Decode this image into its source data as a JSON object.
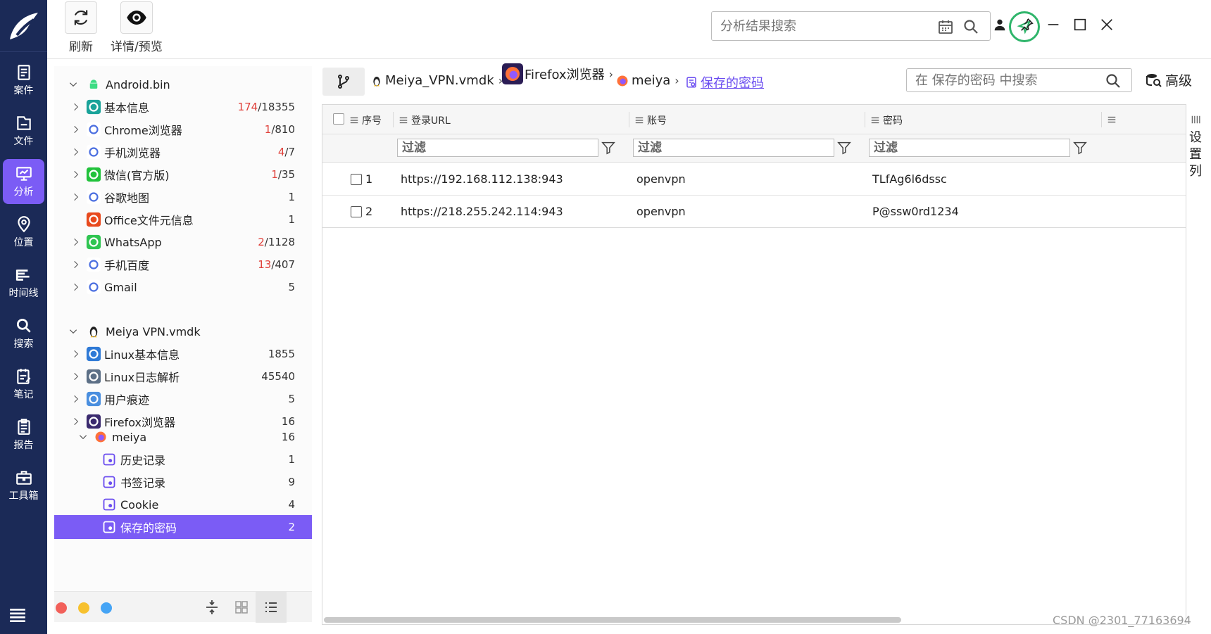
{
  "rail": {
    "items": [
      {
        "label": "案件",
        "icon": "case-icon"
      },
      {
        "label": "文件",
        "icon": "folder-icon"
      },
      {
        "label": "分析",
        "icon": "analysis-icon",
        "active": true
      },
      {
        "label": "位置",
        "icon": "location-icon"
      },
      {
        "label": "时间线",
        "icon": "timeline-icon"
      },
      {
        "label": "搜索",
        "icon": "search-icon"
      },
      {
        "label": "笔记",
        "icon": "note-icon"
      },
      {
        "label": "报告",
        "icon": "report-icon"
      },
      {
        "label": "工具箱",
        "icon": "toolbox-icon"
      }
    ]
  },
  "toolbar": {
    "refresh_label": "刷新",
    "detail_label": "详情/预览",
    "search_placeholder": "分析结果搜索"
  },
  "tree": {
    "source1": {
      "label": "Android.bin"
    },
    "source1_items": [
      {
        "label": "基本信息",
        "hit": "174",
        "total": "/18355",
        "icon": "basic-info-icon",
        "color": "#1aa39a"
      },
      {
        "label": "Chrome浏览器",
        "hit": "1",
        "total": "/810",
        "icon": "chrome-icon",
        "color": "#ffffff"
      },
      {
        "label": "手机浏览器",
        "hit": "4",
        "total": "/7",
        "icon": "mobile-browser-icon",
        "color": "#ffffff"
      },
      {
        "label": "微信(官方版)",
        "hit": "1",
        "total": "/35",
        "icon": "wechat-icon",
        "color": "#21c23b"
      },
      {
        "label": "谷歌地图",
        "hit": "",
        "total": "1",
        "icon": "google-maps-icon",
        "color": "#ffffff"
      },
      {
        "label": "Office文件元信息",
        "hit": "",
        "total": "1",
        "icon": "office-icon",
        "color": "#e8491d"
      },
      {
        "label": "WhatsApp",
        "hit": "2",
        "total": "/1128",
        "icon": "whatsapp-icon",
        "color": "#2fc551"
      },
      {
        "label": "手机百度",
        "hit": "13",
        "total": "/407",
        "icon": "baidu-icon",
        "color": "#ffffff"
      },
      {
        "label": "Gmail",
        "hit": "",
        "total": "5",
        "icon": "gmail-icon",
        "color": "#ffffff"
      }
    ],
    "source2": {
      "label": "Meiya VPN.vmdk"
    },
    "source2_items": [
      {
        "label": "Linux基本信息",
        "total": "1855",
        "icon": "linux-info-icon",
        "color": "#2f7ad6"
      },
      {
        "label": "Linux日志解析",
        "total": "45540",
        "icon": "log-icon",
        "color": "#5c6f86"
      },
      {
        "label": "用户痕迹",
        "total": "5",
        "icon": "user-trace-icon",
        "color": "#4a8fdf"
      },
      {
        "label": "Firefox浏览器",
        "total": "16",
        "icon": "firefox-icon",
        "color": "#3a2a6e"
      }
    ],
    "profile": {
      "label": "meiya",
      "total": "16"
    },
    "profile_items": [
      {
        "label": "历史记录",
        "total": "1",
        "icon": "history-icon"
      },
      {
        "label": "书签记录",
        "total": "9",
        "icon": "bookmark-icon"
      },
      {
        "label": "Cookie",
        "total": "4",
        "icon": "cookie-icon"
      },
      {
        "label": "保存的密码",
        "total": "2",
        "icon": "saved-password-icon",
        "selected": true
      }
    ]
  },
  "breadcrumb": {
    "items": [
      "Meiya_VPN.vmdk",
      "Firefox浏览器",
      "meiya",
      "保存的密码"
    ]
  },
  "local_search": {
    "placeholder": "在 保存的密码 中搜索"
  },
  "advanced_label": "高级",
  "table": {
    "columns": [
      "序号",
      "登录URL",
      "账号",
      "密码"
    ],
    "filter_placeholder": "过滤",
    "rows": [
      {
        "index": "1",
        "url": "https://192.168.112.138:943",
        "account": "openvpn",
        "password": "TLfAg6l6dssc"
      },
      {
        "index": "2",
        "url": "https://218.255.242.114:943",
        "account": "openvpn",
        "password": "P@ssw0rd1234"
      }
    ]
  },
  "column_setting_label": [
    "设",
    "置",
    "列"
  ],
  "watermark": "CSDN @2301_77163694",
  "colors": {
    "rail": "#1b2a57",
    "accent": "#7b5cf5",
    "hit": "#e0413b",
    "locate": "#2fb56b"
  }
}
